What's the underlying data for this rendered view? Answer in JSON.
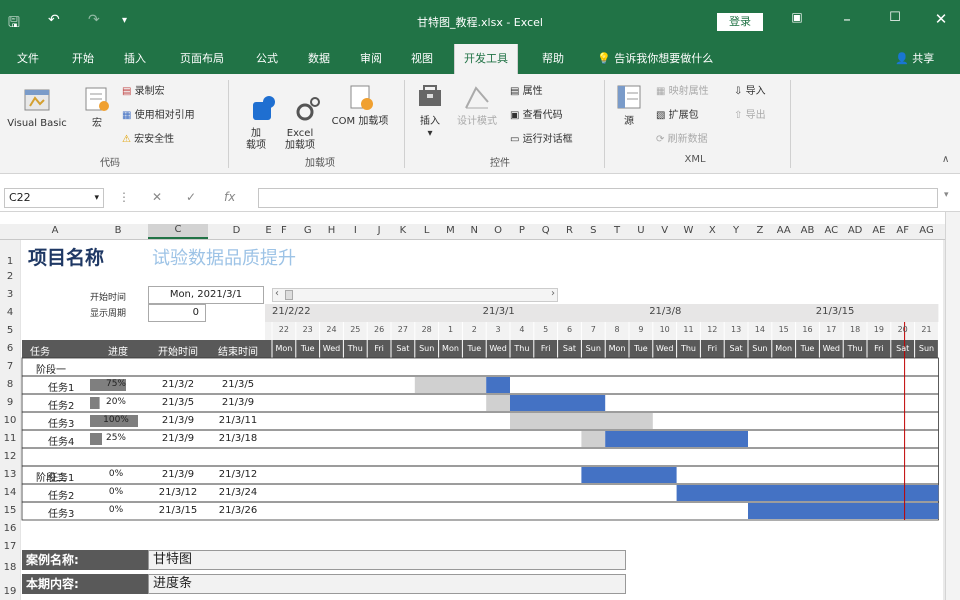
{
  "titlebar": {
    "title": "甘特图_教程.xlsx - Excel",
    "login": "登录",
    "qa_icons": [
      "save-icon",
      "undo-icon",
      "redo-icon",
      "customize-icon"
    ]
  },
  "tabs": [
    "文件",
    "开始",
    "插入",
    "页面布局",
    "公式",
    "数据",
    "审阅",
    "视图",
    "开发工具",
    "帮助"
  ],
  "active_tab": "开发工具",
  "tellme": "告诉我你想要做什么",
  "share": "共享",
  "ribbon": {
    "code": {
      "label": "代码",
      "visual_basic": "Visual Basic",
      "macros": "宏",
      "record": "录制宏",
      "relative": "使用相对引用",
      "security": "宏安全性"
    },
    "addins": {
      "label": "加载项",
      "addins": "加\n载项",
      "excel_addins": "Excel\n加载项",
      "com_addins": "COM 加载项"
    },
    "controls": {
      "label": "控件",
      "insert": "插入",
      "design": "设计模式",
      "properties": "属性",
      "view_code": "查看代码",
      "run_dialog": "运行对话框"
    },
    "xml": {
      "label": "XML",
      "source": "源",
      "map_props": "映射属性",
      "expansion": "扩展包",
      "refresh": "刷新数据",
      "import": "导入",
      "export": "导出"
    }
  },
  "formula": {
    "namebox": "C22",
    "cancel": "✕",
    "enter": "✓",
    "fx": "fx",
    "value": ""
  },
  "columns": [
    "A",
    "B",
    "C",
    "D",
    "E",
    "F",
    "G",
    "H",
    "I",
    "J",
    "K",
    "L",
    "M",
    "N",
    "O",
    "P",
    "Q",
    "R",
    "S",
    "T",
    "U",
    "V",
    "W",
    "X",
    "Y",
    "Z",
    "AA",
    "AB",
    "AC",
    "AD",
    "AE",
    "AF",
    "AG"
  ],
  "rows": [
    "1",
    "2",
    "3",
    "4",
    "5",
    "6",
    "7",
    "8",
    "9",
    "10",
    "11",
    "12",
    "13",
    "14",
    "15",
    "16",
    "17",
    "18",
    "19"
  ],
  "sheet": {
    "project_label": "项目名称",
    "project_name": "试验数据品质提升",
    "start_label": "开始时间",
    "start_value": "Mon, 2021/3/1",
    "week_label": "显示周期",
    "week_value": "0",
    "week_starts": [
      "21/2/22",
      "21/3/1",
      "21/3/8",
      "21/3/15"
    ],
    "days": [
      "22",
      "23",
      "24",
      "25",
      "26",
      "27",
      "28",
      "1",
      "2",
      "3",
      "4",
      "5",
      "6",
      "7",
      "8",
      "9",
      "10",
      "11",
      "12",
      "13",
      "14",
      "15",
      "16",
      "17",
      "18",
      "19",
      "20",
      "21"
    ],
    "weekdays": [
      "Mon",
      "Tue",
      "Wed",
      "Thu",
      "Fri",
      "Sat",
      "Sun",
      "Mon",
      "Tue",
      "Wed",
      "Thu",
      "Fri",
      "Sat",
      "Sun",
      "Mon",
      "Tue",
      "Wed",
      "Thu",
      "Fri",
      "Sat",
      "Sun",
      "Mon",
      "Tue",
      "Wed",
      "Thu",
      "Fri",
      "Sat",
      "Sun"
    ],
    "headers": [
      "任务",
      "进度",
      "开始时间",
      "结束时间"
    ],
    "phase1": "阶段一",
    "phase2": "阶段二",
    "tasks": [
      {
        "name": "任务1",
        "progress": "75%",
        "pct": 75,
        "start": "21/3/2",
        "end": "21/3/5",
        "gray": [
          6,
          9
        ],
        "blue": [
          9,
          10
        ]
      },
      {
        "name": "任务2",
        "progress": "20%",
        "pct": 20,
        "start": "21/3/5",
        "end": "21/3/9",
        "gray": [
          9,
          10
        ],
        "blue": [
          10,
          14
        ]
      },
      {
        "name": "任务3",
        "progress": "100%",
        "pct": 100,
        "start": "21/3/9",
        "end": "21/3/11",
        "gray": [
          10,
          16
        ],
        "blue": null
      },
      {
        "name": "任务4",
        "progress": "25%",
        "pct": 25,
        "start": "21/3/9",
        "end": "21/3/18",
        "gray": [
          13,
          14
        ],
        "blue": [
          14,
          20
        ]
      }
    ],
    "tasks2": [
      {
        "name": "任务1",
        "progress": "0%",
        "pct": 0,
        "start": "21/3/9",
        "end": "21/3/12",
        "gray": null,
        "blue": [
          13,
          17
        ]
      },
      {
        "name": "任务2",
        "progress": "0%",
        "pct": 0,
        "start": "21/3/12",
        "end": "21/3/24",
        "gray": null,
        "blue": [
          17,
          28
        ]
      },
      {
        "name": "任务3",
        "progress": "0%",
        "pct": 0,
        "start": "21/3/15",
        "end": "21/3/26",
        "gray": null,
        "blue": [
          20,
          28
        ]
      }
    ],
    "case_label": "案例名称:",
    "case_value": "甘特图",
    "content_label": "本期内容:",
    "content_value": "进度条"
  },
  "colors": {
    "excel_green": "#217346",
    "bar_blue": "#4472c4",
    "bar_gray": "#d0d0d0",
    "today_line": "#c00000",
    "header_dark": "#595959"
  }
}
